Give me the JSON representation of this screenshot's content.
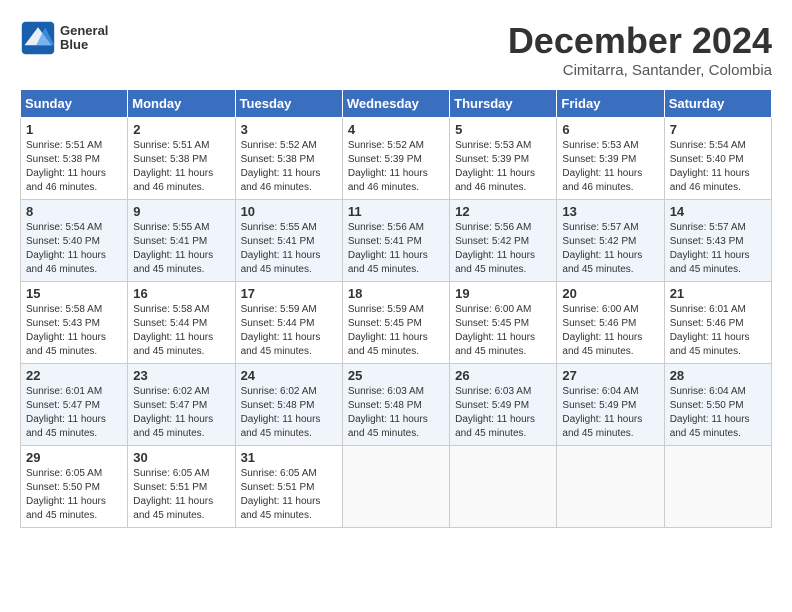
{
  "header": {
    "logo_text_line1": "General",
    "logo_text_line2": "Blue",
    "month": "December 2024",
    "location": "Cimitarra, Santander, Colombia"
  },
  "weekdays": [
    "Sunday",
    "Monday",
    "Tuesday",
    "Wednesday",
    "Thursday",
    "Friday",
    "Saturday"
  ],
  "weeks": [
    [
      {
        "day": "1",
        "sunrise": "5:51 AM",
        "sunset": "5:38 PM",
        "daylight": "11 hours and 46 minutes."
      },
      {
        "day": "2",
        "sunrise": "5:51 AM",
        "sunset": "5:38 PM",
        "daylight": "11 hours and 46 minutes."
      },
      {
        "day": "3",
        "sunrise": "5:52 AM",
        "sunset": "5:38 PM",
        "daylight": "11 hours and 46 minutes."
      },
      {
        "day": "4",
        "sunrise": "5:52 AM",
        "sunset": "5:39 PM",
        "daylight": "11 hours and 46 minutes."
      },
      {
        "day": "5",
        "sunrise": "5:53 AM",
        "sunset": "5:39 PM",
        "daylight": "11 hours and 46 minutes."
      },
      {
        "day": "6",
        "sunrise": "5:53 AM",
        "sunset": "5:39 PM",
        "daylight": "11 hours and 46 minutes."
      },
      {
        "day": "7",
        "sunrise": "5:54 AM",
        "sunset": "5:40 PM",
        "daylight": "11 hours and 46 minutes."
      }
    ],
    [
      {
        "day": "8",
        "sunrise": "5:54 AM",
        "sunset": "5:40 PM",
        "daylight": "11 hours and 46 minutes."
      },
      {
        "day": "9",
        "sunrise": "5:55 AM",
        "sunset": "5:41 PM",
        "daylight": "11 hours and 45 minutes."
      },
      {
        "day": "10",
        "sunrise": "5:55 AM",
        "sunset": "5:41 PM",
        "daylight": "11 hours and 45 minutes."
      },
      {
        "day": "11",
        "sunrise": "5:56 AM",
        "sunset": "5:41 PM",
        "daylight": "11 hours and 45 minutes."
      },
      {
        "day": "12",
        "sunrise": "5:56 AM",
        "sunset": "5:42 PM",
        "daylight": "11 hours and 45 minutes."
      },
      {
        "day": "13",
        "sunrise": "5:57 AM",
        "sunset": "5:42 PM",
        "daylight": "11 hours and 45 minutes."
      },
      {
        "day": "14",
        "sunrise": "5:57 AM",
        "sunset": "5:43 PM",
        "daylight": "11 hours and 45 minutes."
      }
    ],
    [
      {
        "day": "15",
        "sunrise": "5:58 AM",
        "sunset": "5:43 PM",
        "daylight": "11 hours and 45 minutes."
      },
      {
        "day": "16",
        "sunrise": "5:58 AM",
        "sunset": "5:44 PM",
        "daylight": "11 hours and 45 minutes."
      },
      {
        "day": "17",
        "sunrise": "5:59 AM",
        "sunset": "5:44 PM",
        "daylight": "11 hours and 45 minutes."
      },
      {
        "day": "18",
        "sunrise": "5:59 AM",
        "sunset": "5:45 PM",
        "daylight": "11 hours and 45 minutes."
      },
      {
        "day": "19",
        "sunrise": "6:00 AM",
        "sunset": "5:45 PM",
        "daylight": "11 hours and 45 minutes."
      },
      {
        "day": "20",
        "sunrise": "6:00 AM",
        "sunset": "5:46 PM",
        "daylight": "11 hours and 45 minutes."
      },
      {
        "day": "21",
        "sunrise": "6:01 AM",
        "sunset": "5:46 PM",
        "daylight": "11 hours and 45 minutes."
      }
    ],
    [
      {
        "day": "22",
        "sunrise": "6:01 AM",
        "sunset": "5:47 PM",
        "daylight": "11 hours and 45 minutes."
      },
      {
        "day": "23",
        "sunrise": "6:02 AM",
        "sunset": "5:47 PM",
        "daylight": "11 hours and 45 minutes."
      },
      {
        "day": "24",
        "sunrise": "6:02 AM",
        "sunset": "5:48 PM",
        "daylight": "11 hours and 45 minutes."
      },
      {
        "day": "25",
        "sunrise": "6:03 AM",
        "sunset": "5:48 PM",
        "daylight": "11 hours and 45 minutes."
      },
      {
        "day": "26",
        "sunrise": "6:03 AM",
        "sunset": "5:49 PM",
        "daylight": "11 hours and 45 minutes."
      },
      {
        "day": "27",
        "sunrise": "6:04 AM",
        "sunset": "5:49 PM",
        "daylight": "11 hours and 45 minutes."
      },
      {
        "day": "28",
        "sunrise": "6:04 AM",
        "sunset": "5:50 PM",
        "daylight": "11 hours and 45 minutes."
      }
    ],
    [
      {
        "day": "29",
        "sunrise": "6:05 AM",
        "sunset": "5:50 PM",
        "daylight": "11 hours and 45 minutes."
      },
      {
        "day": "30",
        "sunrise": "6:05 AM",
        "sunset": "5:51 PM",
        "daylight": "11 hours and 45 minutes."
      },
      {
        "day": "31",
        "sunrise": "6:05 AM",
        "sunset": "5:51 PM",
        "daylight": "11 hours and 45 minutes."
      },
      null,
      null,
      null,
      null
    ]
  ]
}
